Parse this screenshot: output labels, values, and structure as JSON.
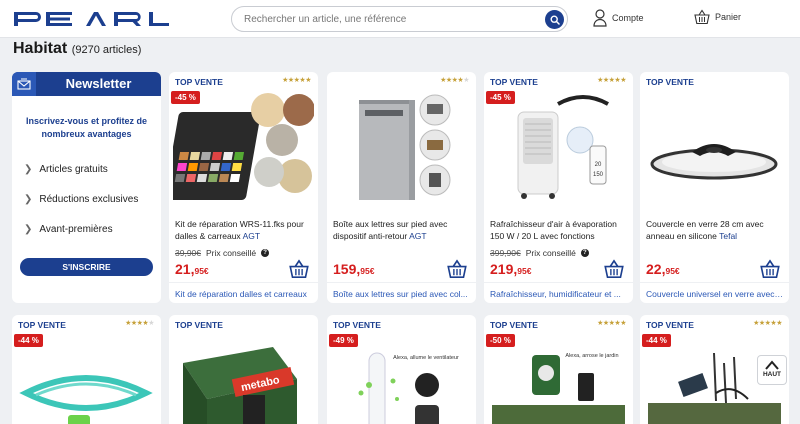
{
  "header": {
    "logo_text": "PEARL",
    "search_placeholder": "Rechercher un article, une référence",
    "account_label": "Compte",
    "cart_label": "Panier"
  },
  "page": {
    "title": "Habitat",
    "count": "(9270 articles)"
  },
  "newsletter": {
    "title": "Newsletter",
    "intro": "Inscrivez-vous et profitez de nombreux avantages",
    "items": [
      "Articles gratuits",
      "Réductions exclusives",
      "Avant-premières"
    ],
    "button_label": "S'INSCRIRE"
  },
  "colors": {
    "brand_blue": "#1c3f8f",
    "price_red": "#d51e1e",
    "badge_red": "#d51e1e",
    "star_gold": "#c6a13a",
    "link_blue": "#2b58b6"
  },
  "products_row1": [
    {
      "label": "TOP VENTE",
      "rating": 5,
      "discount": "-45 %",
      "name": "Kit de réparation WRS-11.fks pour dalles & carreaux",
      "brand": "AGT",
      "old_price": "39,90€",
      "rrp_label": "Prix conseillé",
      "price_main": "21,",
      "price_cents": "95€",
      "category": "Kit de réparation dalles et carreaux"
    },
    {
      "label": "",
      "rating": 4,
      "discount": "",
      "name": "Boîte aux lettres sur pied avec dispositif anti-retour",
      "brand": "AGT",
      "old_price": "",
      "rrp_label": "",
      "price_main": "159,",
      "price_cents": "95€",
      "category": "Boîte aux lettres sur pied avec col..."
    },
    {
      "label": "TOP VENTE",
      "rating": 5,
      "discount": "-45 %",
      "name": "Rafraîchisseur d'air à évaporation 150 W / 20 L avec fonctions",
      "brand": "",
      "old_price": "399,90€",
      "rrp_label": "Prix conseillé",
      "price_main": "219,",
      "price_cents": "95€",
      "category": "Rafraîchisseur, humidificateur et ..."
    },
    {
      "label": "TOP VENTE",
      "rating": 0,
      "discount": "",
      "name": "Couvercle en verre 28 cm avec anneau en silicone",
      "brand": "Tefal",
      "old_price": "",
      "rrp_label": "",
      "price_main": "22,",
      "price_cents": "95€",
      "category": "Couvercle universel en verre avec bo..."
    }
  ],
  "products_row2": [
    {
      "label": "TOP VENTE",
      "rating": 4,
      "discount": "-44 %",
      "image_text": ""
    },
    {
      "label": "TOP VENTE",
      "rating": 0,
      "discount": "",
      "image_text": "metabo"
    },
    {
      "label": "TOP VENTE",
      "rating": 0,
      "discount": "-49 %",
      "image_text": "Alexa, allume le ventilateur"
    },
    {
      "label": "TOP VENTE",
      "rating": 5,
      "discount": "-50 %",
      "image_text": "Alexa, arrose le jardin"
    },
    {
      "label": "TOP VENTE",
      "rating": 5,
      "discount": "-44 %",
      "image_text": ""
    }
  ],
  "back_to_top": {
    "label": "HAUT"
  }
}
